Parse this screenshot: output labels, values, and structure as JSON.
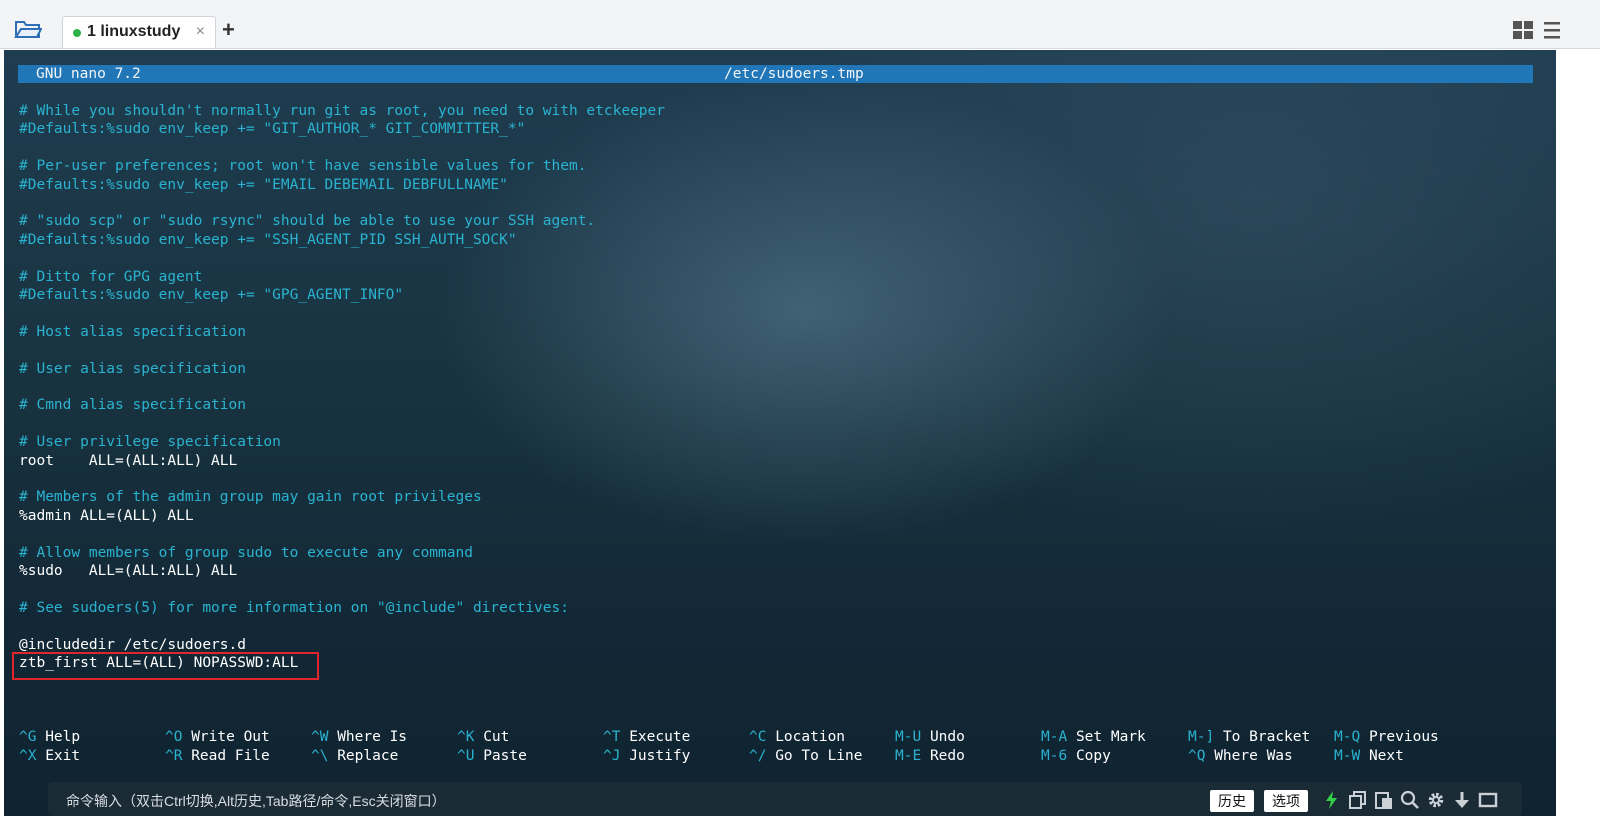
{
  "tabbar": {
    "tab_title": "1 linuxstudy",
    "tab_close": "×",
    "add_tab": "+"
  },
  "nano": {
    "app_name": "GNU nano 7.2",
    "file_name": "/etc/sudoers.tmp",
    "lines": [
      {
        "text": "# While you shouldn't normally run git as root, you need to with etckeeper",
        "type": "comment"
      },
      {
        "text": "#Defaults:%sudo env_keep += \"GIT_AUTHOR_* GIT_COMMITTER_*\"",
        "type": "comment"
      },
      {
        "text": "",
        "type": "blank"
      },
      {
        "text": "# Per-user preferences; root won't have sensible values for them.",
        "type": "comment"
      },
      {
        "text": "#Defaults:%sudo env_keep += \"EMAIL DEBEMAIL DEBFULLNAME\"",
        "type": "comment"
      },
      {
        "text": "",
        "type": "blank"
      },
      {
        "text": "# \"sudo scp\" or \"sudo rsync\" should be able to use your SSH agent.",
        "type": "comment"
      },
      {
        "text": "#Defaults:%sudo env_keep += \"SSH_AGENT_PID SSH_AUTH_SOCK\"",
        "type": "comment"
      },
      {
        "text": "",
        "type": "blank"
      },
      {
        "text": "# Ditto for GPG agent",
        "type": "comment"
      },
      {
        "text": "#Defaults:%sudo env_keep += \"GPG_AGENT_INFO\"",
        "type": "comment"
      },
      {
        "text": "",
        "type": "blank"
      },
      {
        "text": "# Host alias specification",
        "type": "comment"
      },
      {
        "text": "",
        "type": "blank"
      },
      {
        "text": "# User alias specification",
        "type": "comment"
      },
      {
        "text": "",
        "type": "blank"
      },
      {
        "text": "# Cmnd alias specification",
        "type": "comment"
      },
      {
        "text": "",
        "type": "blank"
      },
      {
        "text": "# User privilege specification",
        "type": "comment"
      },
      {
        "text": "root    ALL=(ALL:ALL) ALL",
        "type": "code"
      },
      {
        "text": "",
        "type": "blank"
      },
      {
        "text": "# Members of the admin group may gain root privileges",
        "type": "comment"
      },
      {
        "text": "%admin ALL=(ALL) ALL",
        "type": "code"
      },
      {
        "text": "",
        "type": "blank"
      },
      {
        "text": "# Allow members of group sudo to execute any command",
        "type": "comment"
      },
      {
        "text": "%sudo   ALL=(ALL:ALL) ALL",
        "type": "code"
      },
      {
        "text": "",
        "type": "blank"
      },
      {
        "text": "# See sudoers(5) for more information on \"@include\" directives:",
        "type": "comment"
      },
      {
        "text": "",
        "type": "blank"
      },
      {
        "text": "@includedir /etc/sudoers.d",
        "type": "code"
      },
      {
        "text": "ztb_first ALL=(ALL) NOPASSWD:ALL",
        "type": "code"
      }
    ],
    "shortcuts": [
      {
        "key": "^G",
        "label": "Help"
      },
      {
        "key": "^X",
        "label": "Exit"
      },
      {
        "key": "^O",
        "label": "Write Out"
      },
      {
        "key": "^R",
        "label": "Read File"
      },
      {
        "key": "^W",
        "label": "Where Is"
      },
      {
        "key": "^\\",
        "label": "Replace"
      },
      {
        "key": "^K",
        "label": "Cut"
      },
      {
        "key": "^U",
        "label": "Paste"
      },
      {
        "key": "^T",
        "label": "Execute"
      },
      {
        "key": "^J",
        "label": "Justify"
      },
      {
        "key": "^C",
        "label": "Location"
      },
      {
        "key": "^/",
        "label": "Go To Line"
      },
      {
        "key": "M-U",
        "label": "Undo"
      },
      {
        "key": "M-E",
        "label": "Redo"
      },
      {
        "key": "M-A",
        "label": "Set Mark"
      },
      {
        "key": "M-6",
        "label": "Copy"
      },
      {
        "key": "M-]",
        "label": "To Bracket"
      },
      {
        "key": "^Q",
        "label": "Where Was"
      },
      {
        "key": "M-Q",
        "label": "Previous"
      },
      {
        "key": "M-W",
        "label": "Next"
      }
    ]
  },
  "cmdbar": {
    "prompt": "命令输入（双击Ctrl切换,Alt历史,Tab路径/命令,Esc关闭窗口）",
    "history_button": "历史",
    "options_button": "选项"
  },
  "colors": {
    "comment": "#2ab3d0",
    "titlebar": "#2076b6",
    "highlight_border": "#e0262c",
    "active_dot": "#2db24a"
  },
  "icons": [
    "folder-icon",
    "grid-view-icon",
    "hamburger-menu-icon",
    "lightning-icon",
    "copy-icon",
    "paste-icon",
    "search-icon",
    "gear-icon",
    "download-icon",
    "maximize-icon"
  ]
}
